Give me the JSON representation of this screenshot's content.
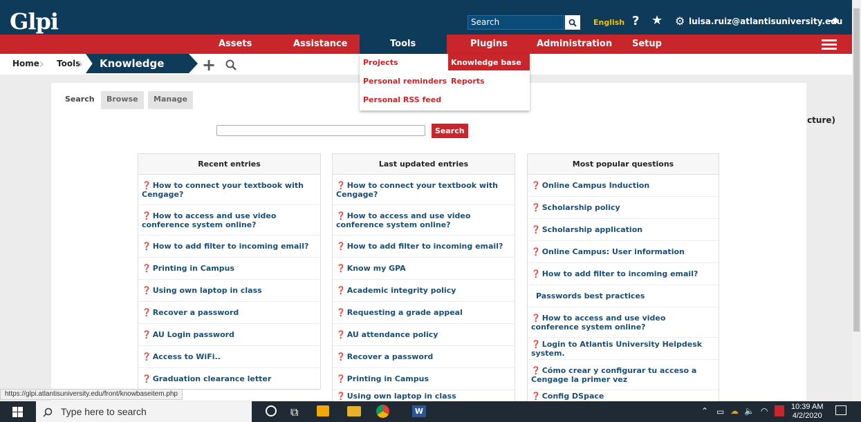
{
  "header": {
    "logo_text": "Glpi",
    "search_placeholder": "Search",
    "language": "English",
    "user_email": "luisa.ruiz@atlantisuniversity.edu"
  },
  "main_menu": [
    "Assets",
    "Assistance",
    "Tools",
    "Plugins",
    "Administration",
    "Setup"
  ],
  "breadcrumb": {
    "home": "Home",
    "tools": "Tools",
    "current": "Knowledge base"
  },
  "entity": "Root entity (tree structure)",
  "tools_dropdown": {
    "projects": "Projects",
    "personal_reminders": "Personal reminders",
    "personal_rss": "Personal RSS feed",
    "knowledge_base": "Knowledge base",
    "reports": "Reports"
  },
  "tabs": {
    "search": "Search",
    "browse": "Browse",
    "manage": "Manage"
  },
  "kb_search_button": "Search",
  "columns": {
    "recent": {
      "title": "Recent entries",
      "entries": [
        "How to connect your textbook with Cengage?",
        "How to access and use video conference system online?",
        "How to add filter to incoming email?",
        "Printing in Campus",
        "Using own laptop in class",
        "Recover a password",
        "AU Login password",
        "Access to WiFi..",
        "Graduation clearance letter"
      ]
    },
    "updated": {
      "title": "Last updated entries",
      "entries": [
        "How to connect your textbook with Cengage?",
        "How to access and use video conference system online?",
        "How to add filter to incoming email?",
        "Know my GPA",
        "Academic integrity policy",
        "Requesting a grade appeal",
        "AU attendance policy",
        "Recover a password",
        "Printing in Campus",
        "Using own laptop in class"
      ]
    },
    "popular": {
      "title": "Most popular questions",
      "entries": [
        "Online Campus Induction",
        "Scholarship policy",
        "Scholarship application",
        "Online Campus: User information",
        "How to add filter to incoming email?",
        "Passwords best practices",
        "How to access and use video conference system online?",
        "Login to Atlantis University Helpdesk system.",
        "Cómo crear y configurar tu acceso a Cengage la primer vez",
        "Config DSpace"
      ]
    }
  },
  "status_url": "https://glpi.atlantisuniversity.edu/front/knowbaseitem.php",
  "taskbar": {
    "search_placeholder": "Type here to search",
    "time": "10:39 AM",
    "date": "4/2/2020"
  },
  "colors": {
    "navy": "#0f3b5a",
    "red": "#c8262b",
    "link": "#1a4f72"
  }
}
